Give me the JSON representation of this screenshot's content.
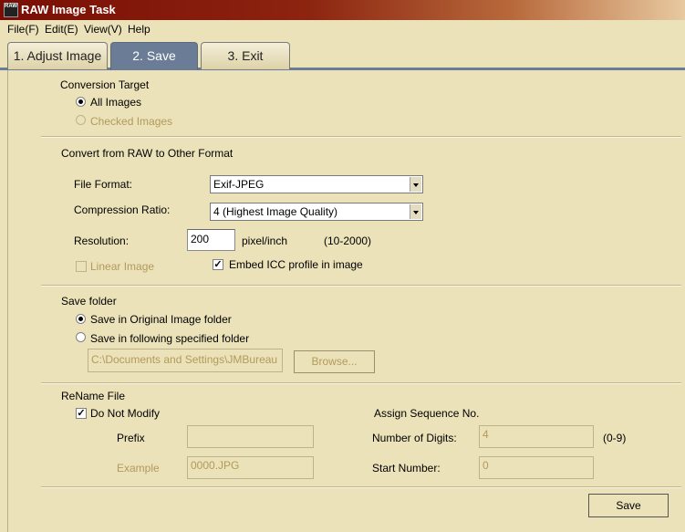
{
  "window": {
    "title": "RAW Image Task",
    "app_icon": "raw-app-icon",
    "icon_text": "RAW"
  },
  "menu": [
    {
      "label": "File(F)"
    },
    {
      "label": "Edit(E)"
    },
    {
      "label": "View(V)"
    },
    {
      "label": "Help"
    }
  ],
  "tabs": [
    {
      "label": "1. Adjust Image",
      "active": false
    },
    {
      "label": "2. Save",
      "active": true
    },
    {
      "label": "3. Exit",
      "active": false
    }
  ],
  "conversion_target": {
    "heading": "Conversion Target",
    "all_images": "All Images",
    "checked_images": "Checked Images",
    "selected": "all_images"
  },
  "convert": {
    "heading": "Convert from RAW to Other Format",
    "file_format_label": "File Format:",
    "file_format_value": "Exif-JPEG",
    "compression_label": "Compression Ratio:",
    "compression_value": "4 (Highest Image Quality)",
    "resolution_label": "Resolution:",
    "resolution_value": "200",
    "resolution_unit": "pixel/inch",
    "resolution_range": "(10-2000)",
    "linear_image_label": "Linear Image",
    "linear_image_checked": false,
    "embed_icc_label": "Embed ICC profile in image",
    "embed_icc_checked": true
  },
  "save_folder": {
    "heading": "Save folder",
    "original_label": "Save in Original Image folder",
    "specified_label": "Save in following specified folder",
    "selected": "original",
    "path_value": "C:\\Documents and Settings\\JMBureau",
    "browse_label": "Browse..."
  },
  "rename": {
    "heading": "ReName File",
    "do_not_modify_label": "Do Not Modify",
    "do_not_modify_checked": true,
    "prefix_label": "Prefix",
    "prefix_value": "",
    "example_label": "Example",
    "example_value": "0000.JPG",
    "sequence_heading": "Assign Sequence No.",
    "digits_label": "Number of Digits:",
    "digits_value": "4",
    "digits_range": "(0-9)",
    "start_label": "Start Number:",
    "start_value": "0"
  },
  "footer": {
    "save_label": "Save"
  },
  "colors": {
    "background": "#ece2b9",
    "active_tab": "#6b7d96",
    "disabled_text": "#b19a5c",
    "titlebar": "#7a0e05"
  }
}
